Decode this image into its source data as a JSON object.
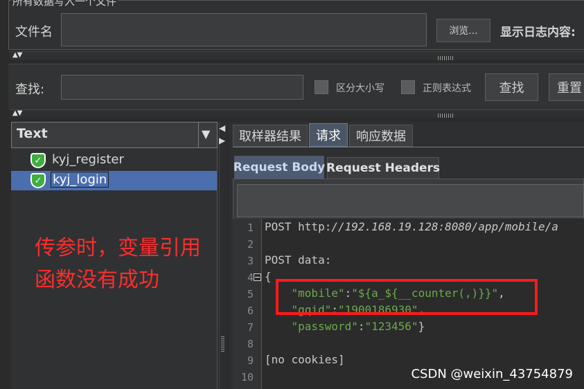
{
  "file_panel": {
    "title": "所有数据写入一个文件",
    "filename_label": "文件名",
    "filename_value": "",
    "browse_label": "浏览...",
    "log_label": "显示日志内容:"
  },
  "search_panel": {
    "find_label": "查找:",
    "find_value": "",
    "case_sensitive_label": "区分大小写",
    "regex_label": "正则表达式",
    "find_button": "查找",
    "reset_button": "重置"
  },
  "tree": {
    "renderer": "Text",
    "items": [
      {
        "label": "kyj_register",
        "status_icon": "success-shield-icon"
      },
      {
        "label": "kyj_login",
        "status_icon": "success-shield-icon",
        "selected": true
      }
    ]
  },
  "tabs": [
    "取样器结果",
    "请求",
    "响应数据"
  ],
  "active_tab": "请求",
  "subtabs": [
    "Request Body",
    "Request Headers"
  ],
  "active_subtab": "Request Body",
  "code_lines": [
    {
      "n": "1",
      "segments": [
        {
          "t": "POST http:",
          "c": "plain"
        },
        {
          "t": "//192.168.19.128:8080/app/mobile/a",
          "c": "italic"
        }
      ]
    },
    {
      "n": "2",
      "segments": []
    },
    {
      "n": "3",
      "segments": [
        {
          "t": "POST data:",
          "c": "plain"
        }
      ]
    },
    {
      "n": "4",
      "segments": [
        {
          "t": "{",
          "c": "plain"
        }
      ]
    },
    {
      "n": "5",
      "segments": [
        {
          "t": "    ",
          "c": "plain"
        },
        {
          "t": "\"mobile\"",
          "c": "green"
        },
        {
          "t": ":",
          "c": "plain"
        },
        {
          "t": "\"${a_${__counter(,)}}\"",
          "c": "green"
        },
        {
          "t": ",",
          "c": "plain"
        }
      ]
    },
    {
      "n": "6",
      "segments": [
        {
          "t": "    ",
          "c": "plain"
        },
        {
          "t": "\"gqid\"",
          "c": "green"
        },
        {
          "t": ":",
          "c": "plain"
        },
        {
          "t": "\"1900186930\"",
          "c": "green"
        },
        {
          "t": ",",
          "c": "plain"
        }
      ]
    },
    {
      "n": "7",
      "segments": [
        {
          "t": "    ",
          "c": "plain"
        },
        {
          "t": "\"password\"",
          "c": "green"
        },
        {
          "t": ":",
          "c": "plain"
        },
        {
          "t": "\"123456\"",
          "c": "green"
        },
        {
          "t": "}",
          "c": "plain"
        }
      ]
    },
    {
      "n": "8",
      "segments": []
    },
    {
      "n": "9",
      "segments": [
        {
          "t": "[no cookies]",
          "c": "plain"
        }
      ]
    },
    {
      "n": "10",
      "segments": []
    }
  ],
  "annotation": {
    "line1": "传参时，变量引用",
    "line2": "函数没有成功"
  },
  "watermark": "CSDN @weixin_43754879",
  "colors": {
    "background": "#2b2b2b",
    "selection": "#4b6eaf",
    "string_green": "#6aab4a",
    "annotation_red": "#ff2d2d"
  }
}
